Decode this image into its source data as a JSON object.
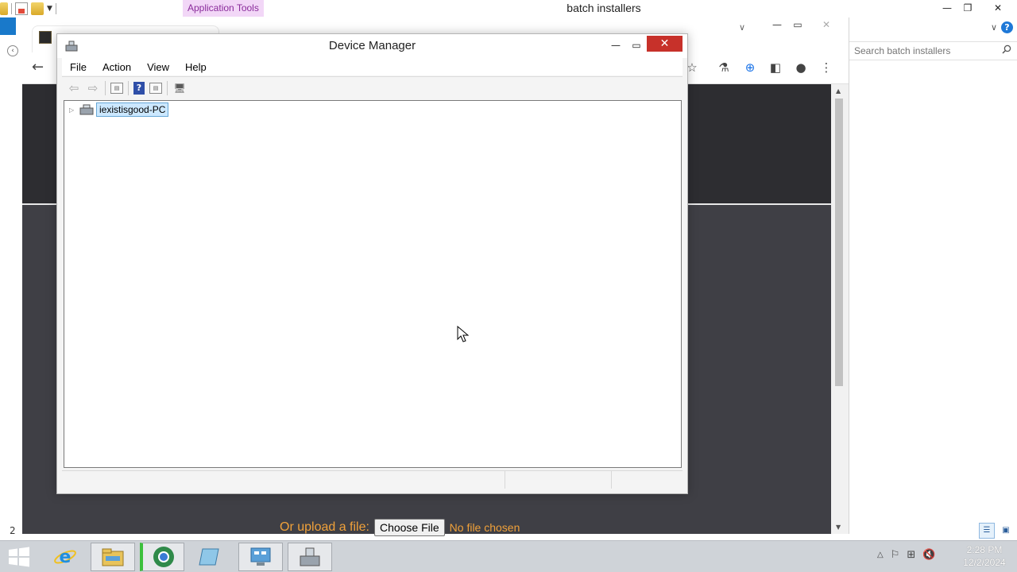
{
  "explorer": {
    "title": "batch installers",
    "context_tab": "Application Tools",
    "search_placeholder": "Search batch installers",
    "left_digit": "2",
    "window_controls": {
      "minimize": "—",
      "maximize": "❐",
      "close": "✕"
    }
  },
  "chrome": {
    "back_glyph": "←",
    "upload_label": "Or upload a file:",
    "choose_file": "Choose File",
    "no_file": "No file chosen",
    "window_controls": {
      "minimize": "—",
      "maximize": "▭",
      "close": "✕"
    }
  },
  "device_manager": {
    "title": "Device Manager",
    "menu": [
      "File",
      "Action",
      "View",
      "Help"
    ],
    "tree_root": "iexistisgood-PC",
    "close_glyph": "✕",
    "minimize_glyph": "—",
    "maximize_glyph": "▭"
  },
  "taskbar": {
    "time": "2:28 PM",
    "date": "12/2/2024"
  },
  "colors": {
    "accent": "#1e78d7",
    "close_red": "#c7312a",
    "upload_orange": "#f0a13a",
    "dark_page": "#3f3f45",
    "selection": "#cce8ff"
  }
}
